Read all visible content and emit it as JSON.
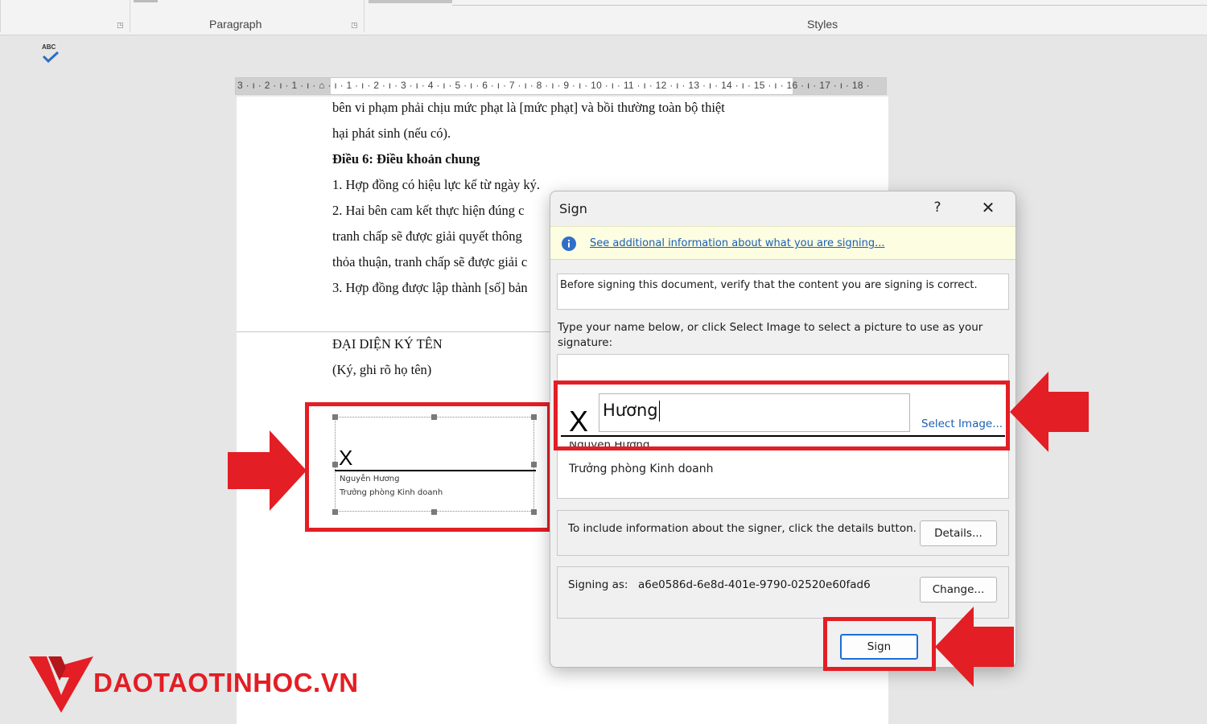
{
  "ribbon": {
    "paragraph_label": "Paragraph",
    "styles_label": "Styles",
    "spell_label": "ABC"
  },
  "ruler": {
    "text": "3 · ı · 2 · ı · 1 · ı ·  ⌂  · ı · 1 · ı · 2 · ı · 3 · ı · 4 · ı · 5 · ı · 6 · ı · 7 · ı · 8 · ı · 9 · ı · 10 · ı · 11 · ı · 12 · ı · 13 · ı · 14 · ı · 15 · ı · 16 · ı · 17 · ı · 18 ·"
  },
  "document": {
    "lines": [
      "bên vi phạm phải chịu mức phạt là [mức phạt] và bồi thường toàn bộ thiệt",
      "hại phát sinh (nếu có).",
      "Điều 6: Điều khoản chung",
      "1. Hợp đồng có hiệu lực kể từ ngày ký.",
      "2. Hai bên cam kết thực hiện đúng c",
      "tranh chấp sẽ được giải quyết thông",
      "thỏa thuận, tranh chấp sẽ được giải c",
      "3. Hợp đồng được lập thành [số] bản"
    ],
    "rep_heading": "ĐẠI DIỆN KÝ TÊN",
    "rep_note": "(Ký, ghi rõ họ tên)",
    "signature_line": {
      "x_mark": "X",
      "signer_name": "Nguyễn Hương",
      "signer_title": "Trưởng phòng Kinh doanh"
    }
  },
  "dialog": {
    "title": "Sign",
    "help": "?",
    "close": "✕",
    "info_link": "See additional information about what you are signing...",
    "verify_text": "Before signing this document, verify that the content you are signing is correct.",
    "instructions": "Type your name below, or click Select Image to select a picture to use as your signature:",
    "x_mark": "X",
    "name_value": "Hương",
    "select_image": "Select Image...",
    "signer_name": "Nguyễn Hương",
    "signer_title": "Trưởng phòng Kinh doanh",
    "details_text": "To include information about the signer, click the details button.",
    "details_button": "Details...",
    "signing_as_label": "Signing as:",
    "signing_as_id": "a6e0586d-6e8d-401e-9790-02520e60fad6",
    "change_button": "Change...",
    "sign_button": "Sign"
  },
  "logo": {
    "text": "DAOTAOTINHOC.VN"
  },
  "colors": {
    "accent_red": "#e31e24",
    "link_blue": "#1a5fb4",
    "info_bar": "#fdfde1"
  }
}
